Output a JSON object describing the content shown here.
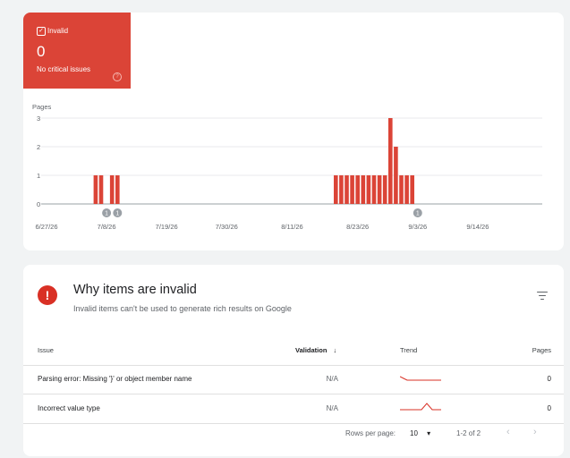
{
  "status_tile": {
    "label": "Invalid",
    "count": "0",
    "subtitle": "No critical issues",
    "color": "#db4437"
  },
  "chart_data": {
    "type": "bar",
    "ylabel": "Pages",
    "ylim": [
      0,
      3
    ],
    "yticks": [
      0,
      1,
      2,
      3
    ],
    "x_tick_labels": [
      "6/27/26",
      "7/8/26",
      "7/19/26",
      "7/30/26",
      "8/11/26",
      "8/23/26",
      "9/3/26",
      "9/14/26"
    ],
    "start_date": "6/27/26",
    "dates": [
      "7/6/26",
      "7/7/26",
      "7/9/26",
      "7/10/26",
      "8/19/26",
      "8/20/26",
      "8/21/26",
      "8/22/26",
      "8/23/26",
      "8/24/26",
      "8/25/26",
      "8/26/26",
      "8/27/26",
      "8/28/26",
      "8/29/26",
      "8/30/26",
      "8/31/26",
      "9/1/26",
      "9/2/26"
    ],
    "values": [
      1,
      1,
      1,
      1,
      1,
      1,
      1,
      1,
      1,
      1,
      1,
      1,
      1,
      1,
      3,
      2,
      1,
      1,
      1
    ],
    "annotations": [
      {
        "date": "7/8/26",
        "label": "1"
      },
      {
        "date": "7/10/26",
        "label": "1"
      },
      {
        "date": "9/3/26",
        "label": "1"
      }
    ],
    "bar_color": "#db4437",
    "grid": true
  },
  "issues": {
    "title": "Why items are invalid",
    "subtitle": "Invalid items can't be used to generate rich results on Google",
    "columns": {
      "issue": "Issue",
      "validation": "Validation",
      "trend": "Trend",
      "pages": "Pages"
    },
    "rows": [
      {
        "issue": "Parsing error: Missing '}' or object member name",
        "validation": "N/A",
        "pages": "0"
      },
      {
        "issue": "Incorrect value type",
        "validation": "N/A",
        "pages": "0"
      }
    ],
    "pagination": {
      "rows_per_page_label": "Rows per page:",
      "rows_per_page": "10",
      "range": "1-2 of 2"
    }
  }
}
